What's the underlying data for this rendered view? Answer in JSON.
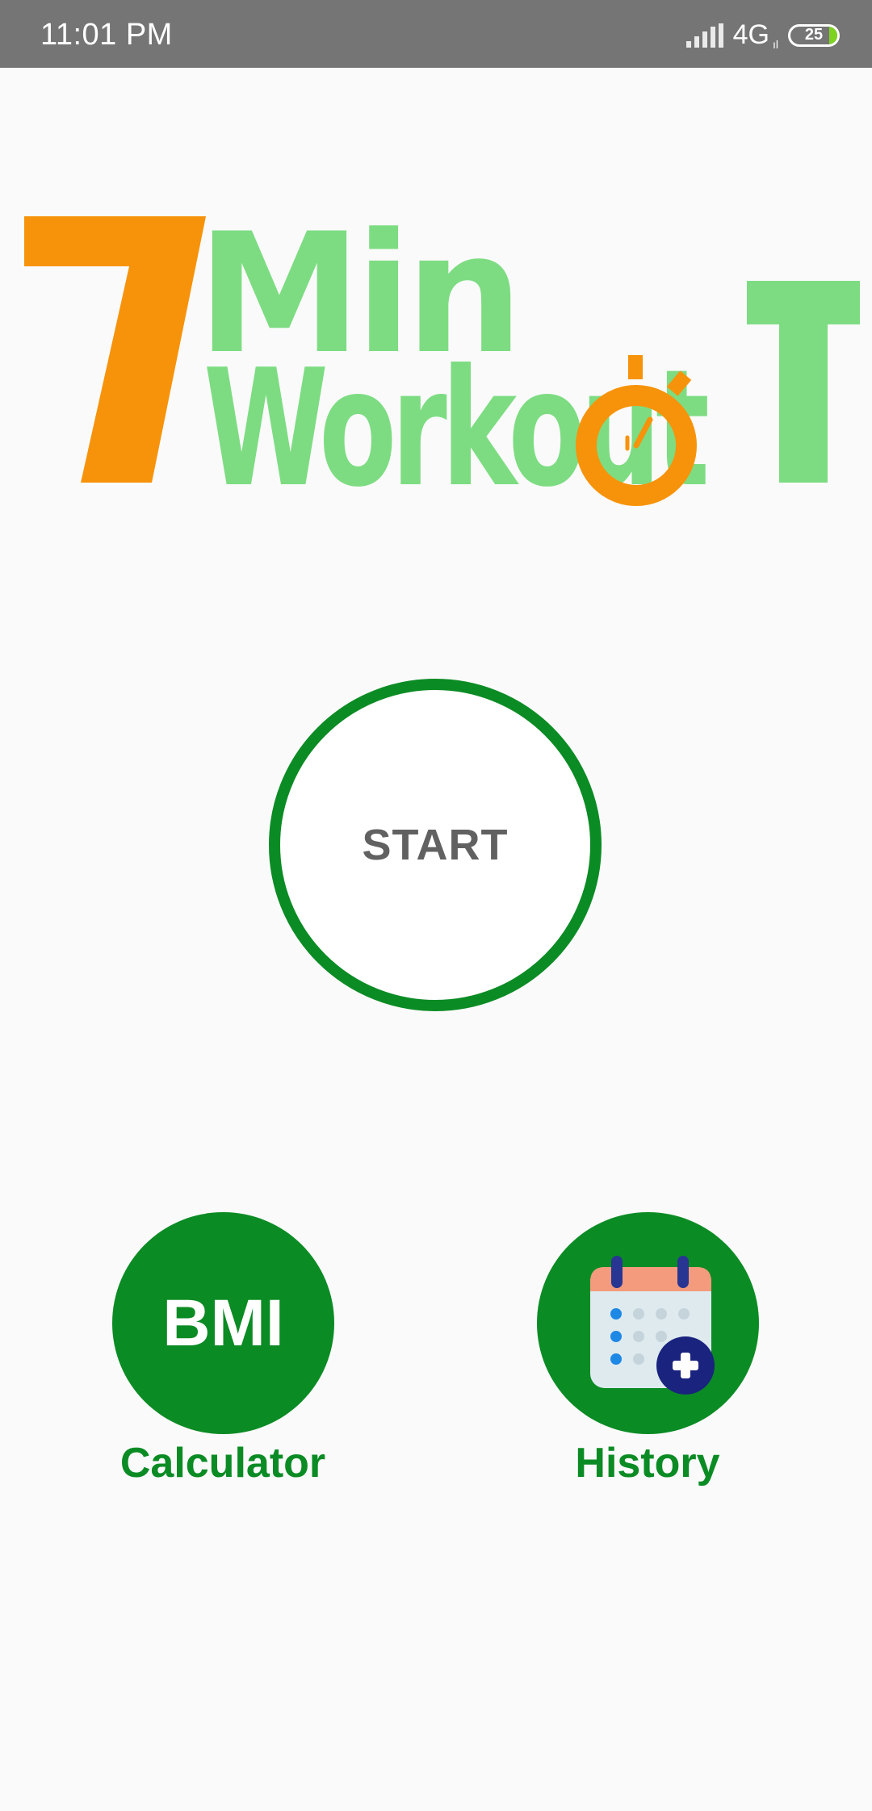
{
  "status_bar": {
    "time": "11:01 PM",
    "network": "4G",
    "network_sub": "ıl",
    "battery": "25"
  },
  "logo": {
    "number": "7",
    "line1": "Min",
    "line2": "Workout",
    "colors": {
      "orange": "#f7930a",
      "green": "#7ddc82"
    }
  },
  "start": {
    "label": "START"
  },
  "bmi": {
    "icon_text": "BMI",
    "caption": "Calculator"
  },
  "history": {
    "icon": "calendar-add-icon",
    "caption": "History"
  },
  "colors": {
    "primary_green": "#0b8b24",
    "status_bar": "#757575",
    "background": "#fafafa"
  }
}
